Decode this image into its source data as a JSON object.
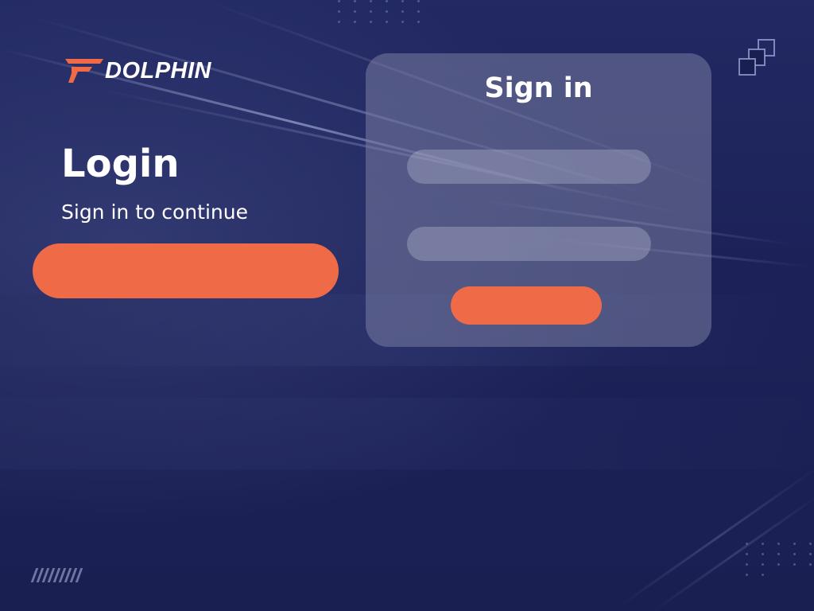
{
  "brand": {
    "name": "DOLPHIN",
    "logo_icon": "dolphin-logo-icon",
    "accent_color": "#ef6a47"
  },
  "hero": {
    "title": "Login",
    "subtitle": "Sign in to continue",
    "cta_label": ""
  },
  "signin_card": {
    "title": "Sign in",
    "field_1_placeholder": "",
    "field_2_placeholder": "",
    "submit_label": ""
  },
  "decorations": {
    "stack_icon": "stacked-squares-icon",
    "stripes_icon": "diagonal-stripes-icon"
  }
}
